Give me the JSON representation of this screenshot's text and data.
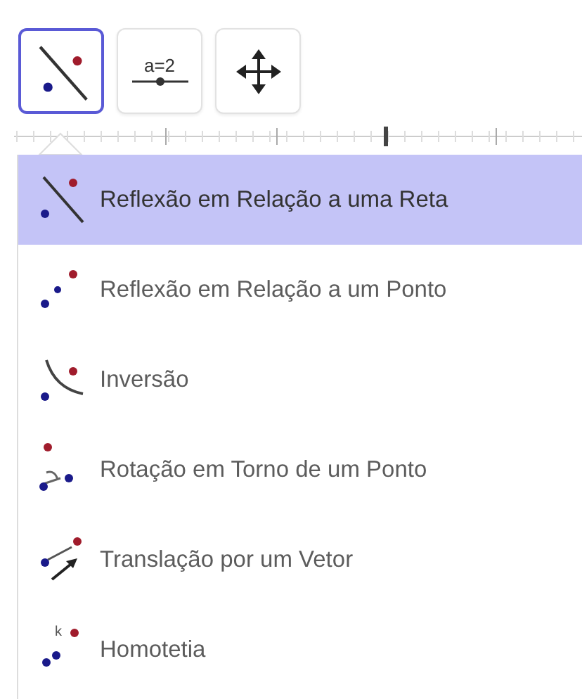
{
  "toolbar": [
    {
      "kind": "reflect-line",
      "selected": true
    },
    {
      "kind": "slider",
      "label": "a=2",
      "selected": false
    },
    {
      "kind": "move",
      "selected": false
    }
  ],
  "menu": [
    {
      "kind": "reflect-line",
      "label": "Reflexão em Relação a uma Reta",
      "selected": true
    },
    {
      "kind": "reflect-point",
      "label": "Reflexão em Relação a um Ponto",
      "selected": false
    },
    {
      "kind": "inversion",
      "label": "Inversão",
      "selected": false
    },
    {
      "kind": "rotation",
      "label": "Rotação em Torno de um Ponto",
      "selected": false
    },
    {
      "kind": "translation",
      "label": "Translação por um Vetor",
      "selected": false
    },
    {
      "kind": "dilation",
      "label": "Homotetia",
      "icon_label": "k",
      "selected": false
    }
  ]
}
